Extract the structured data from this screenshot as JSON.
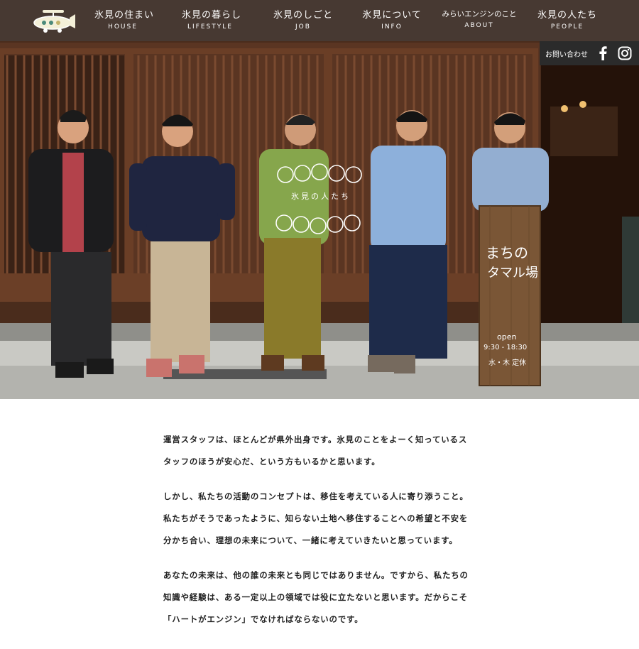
{
  "nav": {
    "items": [
      {
        "jp": "氷見の住まい",
        "en": "HOUSE"
      },
      {
        "jp": "氷見の暮らし",
        "en": "LIFESTYLE"
      },
      {
        "jp": "氷見のしごと",
        "en": "JOB"
      },
      {
        "jp": "氷見について",
        "en": "INFO"
      },
      {
        "jp": "みらいエンジンのこと",
        "en": "ABOUT"
      },
      {
        "jp": "氷見の人たち",
        "en": "PEOPLE"
      }
    ]
  },
  "subbar": {
    "contact_label": "お問い合わせ"
  },
  "hero": {
    "badge_text": "氷見の人たち",
    "sign_line1": "まちの",
    "sign_line2": "タマル場",
    "sign_open": "open",
    "sign_hours": "9:30 - 18:30",
    "sign_closed": "水・木 定休"
  },
  "article": {
    "paragraphs": [
      "運営スタッフは、ほとんどが県外出身です。氷見のことをよーく知っているスタッフのほうが安心だ、という方もいるかと思います。",
      "しかし、私たちの活動のコンセプトは、移住を考えている人に寄り添うこと。私たちがそうであったように、知らない土地へ移住することへの希望と不安を分かち合い、理想の未来について、一緒に考えていきたいと思っています。",
      "あなたの未来は、他の誰の未来とも同じではありません。ですから、私たちの知識や経験は、ある一定以上の領域では役に立たないと思います。だからこそ「ハートがエンジン」でなければならないのです。"
    ]
  },
  "colors": {
    "nav_bg": "#464646",
    "subbar_bg": "#2b2b2b",
    "wood_dark": "#3a2418",
    "text": "#222222"
  }
}
